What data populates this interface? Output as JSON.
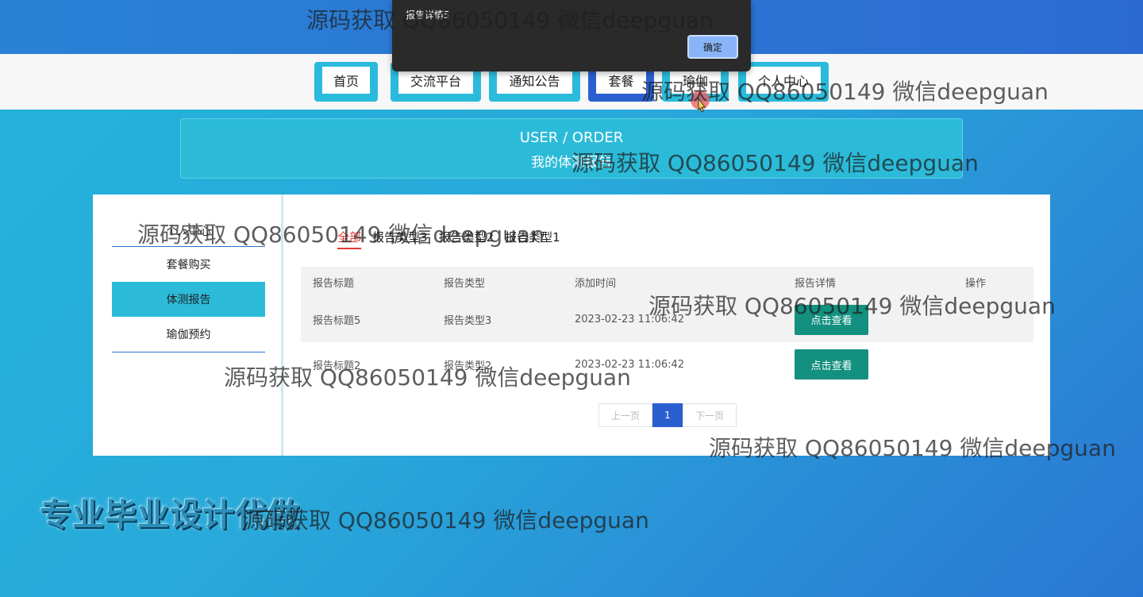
{
  "nav": {
    "items": [
      {
        "label": "首页"
      },
      {
        "label": "交流平台"
      },
      {
        "label": "通知公告"
      },
      {
        "label": "套餐"
      },
      {
        "label": "瑜伽"
      },
      {
        "label": "个人中心"
      }
    ],
    "active_index": 3
  },
  "banner": {
    "en": "USER / ORDER",
    "cn": "我的体测报告"
  },
  "sidebar": {
    "title": "个人中心",
    "items": [
      {
        "label": "套餐购买"
      },
      {
        "label": "体测报告"
      },
      {
        "label": "瑜伽预约"
      }
    ],
    "active_index": 1
  },
  "filters": {
    "tabs": [
      {
        "label": "全部"
      },
      {
        "label": "报告类型3"
      },
      {
        "label": "报告类型2"
      },
      {
        "label": "报告类型1"
      }
    ],
    "active_index": 0
  },
  "table": {
    "headers": [
      "报告标题",
      "报告类型",
      "添加时间",
      "报告详情",
      "操作"
    ],
    "rows": [
      {
        "title": "报告标题5",
        "type": "报告类型3",
        "time": "2023-02-23 11:06:42",
        "button": "点击查看"
      },
      {
        "title": "报告标题2",
        "type": "报告类型2",
        "time": "2023-02-23 11:06:42",
        "button": "点击查看"
      }
    ]
  },
  "pagination": {
    "prev": "上一页",
    "current": "1",
    "next": "下一页"
  },
  "dialog": {
    "message": "报告详情5",
    "ok_label": "确定"
  },
  "footer": {
    "promo": "专业毕业设计代做"
  },
  "watermark": {
    "text": "源码获取 QQ86050149 微信deepguan"
  },
  "colors": {
    "nav_cyan": "#2abbdc",
    "nav_active": "#2a5fcf",
    "button_teal": "#13907f",
    "tab_active_red": "#e53935"
  }
}
